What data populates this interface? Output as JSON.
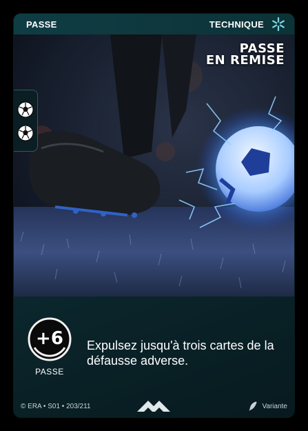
{
  "card": {
    "type": "PASSE",
    "category": "TECHNIQUE",
    "title_line1": "PASSE",
    "title_line2": "EN REMISE",
    "side_icons": [
      "soccer-ball-icon",
      "soccer-ball-icon"
    ],
    "cost": "+6",
    "cost_label": "PASSE",
    "effect": "Expulsez jusqu'à trois cartes de la défausse adverse.",
    "copyright": "© ERA • S01 • 203/211",
    "variant": "Variante"
  },
  "colors": {
    "frame": "#0f3d44",
    "accent": "#7fd4e0",
    "energy": "#3aa8ff"
  }
}
